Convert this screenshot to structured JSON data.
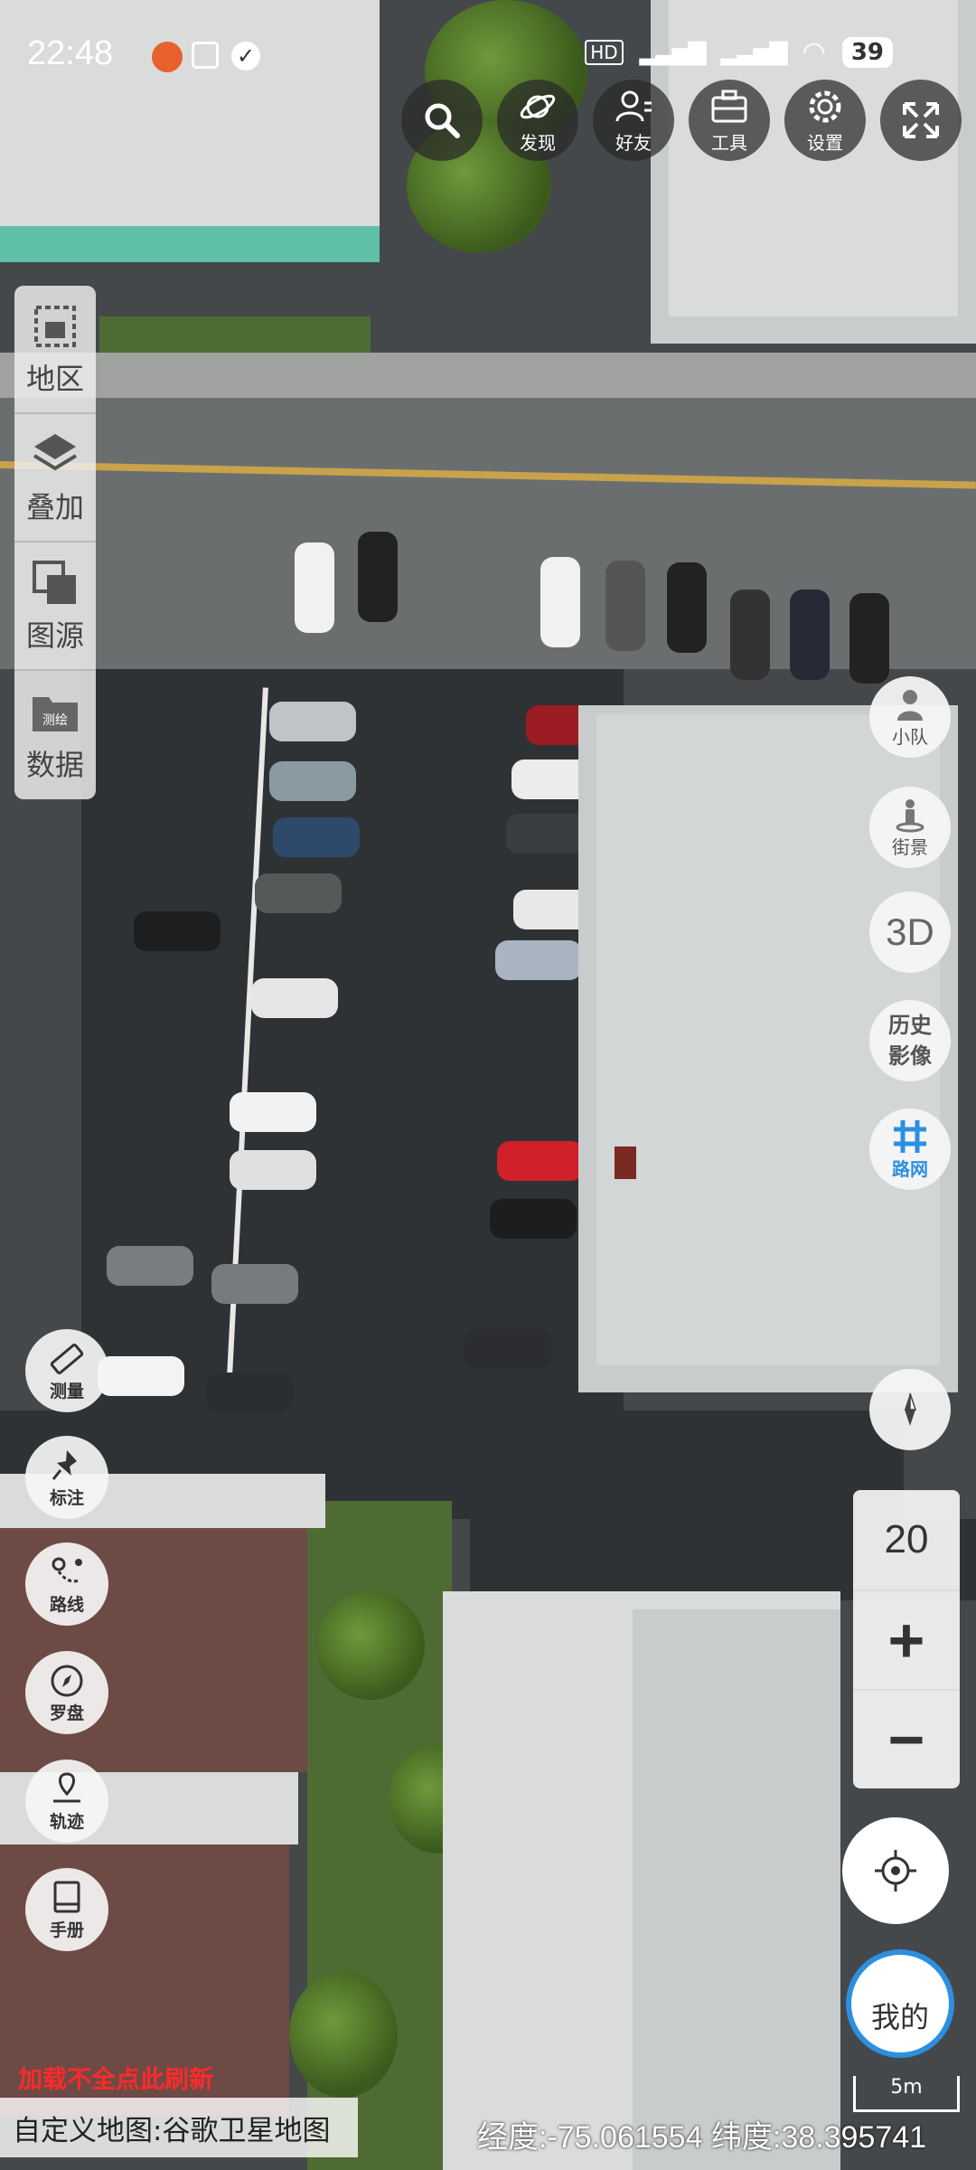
{
  "status_bar": {
    "time": "22:48",
    "battery": "39"
  },
  "toolbar": {
    "search_label": "",
    "discover_label": "发现",
    "friends_label": "好友",
    "tools_label": "工具",
    "settings_label": "设置"
  },
  "left_panel": {
    "items": [
      {
        "label": "地区",
        "icon": "region-icon"
      },
      {
        "label": "叠加",
        "icon": "layers-icon"
      },
      {
        "label": "图源",
        "icon": "map-source-icon"
      },
      {
        "label": "数据",
        "icon": "data-folder-icon"
      }
    ],
    "data_badge": "测绘"
  },
  "left_tools": {
    "measure": "测量",
    "annotate": "标注",
    "route": "路线",
    "compass": "罗盘",
    "track": "轨迹",
    "manual": "手册"
  },
  "right_tools": {
    "team": "小队",
    "street_view": "街景",
    "three_d": "3D",
    "history_line1": "历史",
    "history_line2": "影像",
    "road_net": "路网"
  },
  "zoom": {
    "level": "20",
    "plus": "+",
    "minus": "−"
  },
  "mine_label": "我的",
  "bottom": {
    "refresh_hint": "加载不全点此刷新",
    "map_source": "自定义地图:谷歌卫星地图",
    "coordinates": "经度:-75.061554 纬度:38.395741",
    "scale_label": "5m"
  },
  "colors": {
    "refresh_red": "#ff2a2a",
    "mine_ring_blue": "#2d8fe0",
    "roadnet_blue": "#2d8fe0"
  }
}
